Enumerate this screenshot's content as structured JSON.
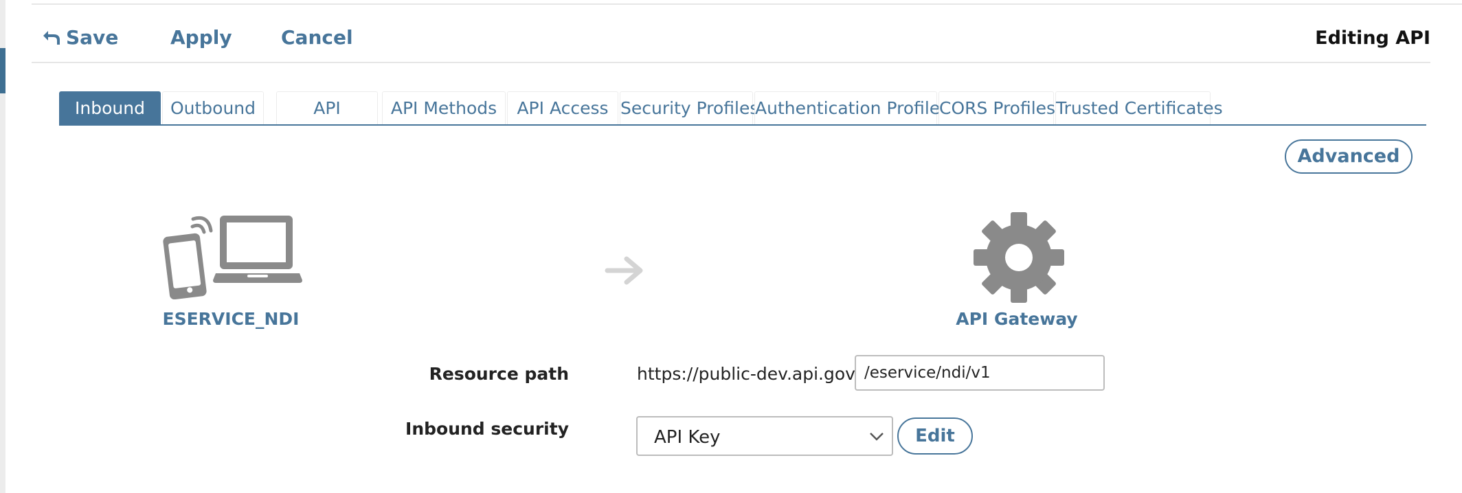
{
  "toolbar": {
    "save_label": "Save",
    "apply_label": "Apply",
    "cancel_label": "Cancel",
    "title": "Editing API"
  },
  "tabs": [
    {
      "label": "Inbound",
      "active": true
    },
    {
      "label": "Outbound",
      "active": false
    },
    {
      "label": "API",
      "active": false
    },
    {
      "label": "API Methods",
      "active": false
    },
    {
      "label": "API Access",
      "active": false
    },
    {
      "label": "Security Profiles",
      "active": false
    },
    {
      "label": "Authentication Profiles",
      "active": false
    },
    {
      "label": "CORS Profiles",
      "active": false
    },
    {
      "label": "Trusted Certificates",
      "active": false
    }
  ],
  "advanced_label": "Advanced",
  "diagram": {
    "client_label": "ESERVICE_NDI",
    "client_icon": "devices-icon",
    "arrow_icon": "arrow-right-icon",
    "gateway_label": "API Gateway",
    "gateway_icon": "gear-icon"
  },
  "form": {
    "resource_path_label": "Resource path",
    "base_url": "https://public-dev.api.gov.sg",
    "resource_path_value": "/eservice/ndi/v1",
    "inbound_security_label": "Inbound security",
    "inbound_security_value": "API Key",
    "edit_label": "Edit"
  },
  "colors": {
    "accent": "#47759a",
    "icon_gray": "#8a8a8a",
    "arrow_gray": "#d4d4d4"
  }
}
